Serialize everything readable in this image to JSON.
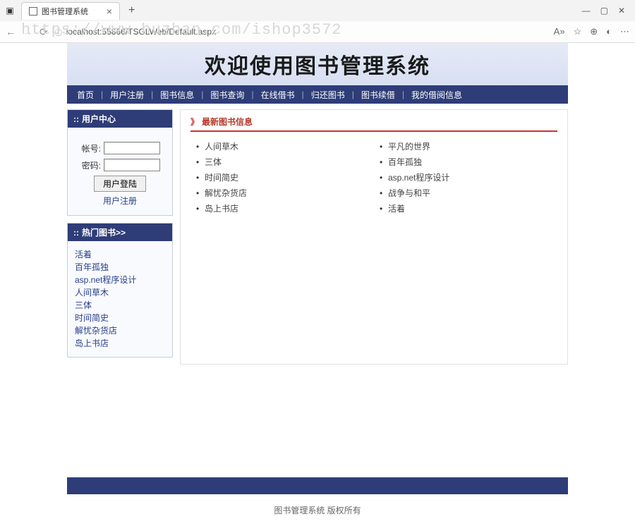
{
  "browser": {
    "tab_title": "图书管理系统",
    "url": "localhost:55866/TSGLWeb/Default.aspx"
  },
  "watermark": "https://www.huzhan.com/ishop3572",
  "banner_title": "欢迎使用图书管理系统",
  "nav": {
    "items": [
      "首页",
      "用户注册",
      "图书信息",
      "图书查询",
      "在线借书",
      "归还图书",
      "图书续借",
      "我的借阅信息"
    ]
  },
  "login_panel": {
    "title": "用户中心",
    "account_label": "帐号:",
    "password_label": "密码:",
    "login_button": "用户登陆",
    "register_link": "用户注册"
  },
  "hot_panel": {
    "title": "热门图书>>",
    "items": [
      "活着",
      "百年孤独",
      "asp.net程序设计",
      "人间草木",
      "三体",
      "时间简史",
      "解忧杂货店",
      "岛上书店"
    ]
  },
  "latest_panel": {
    "title": "最新图书信息",
    "col1": [
      "人间草木",
      "三体",
      "时间简史",
      "解忧杂货店",
      "岛上书店"
    ],
    "col2": [
      "平凡的世界",
      "百年孤独",
      "asp.net程序设计",
      "战争与和平",
      "活着"
    ]
  },
  "footer": "图书管理系统 版权所有"
}
